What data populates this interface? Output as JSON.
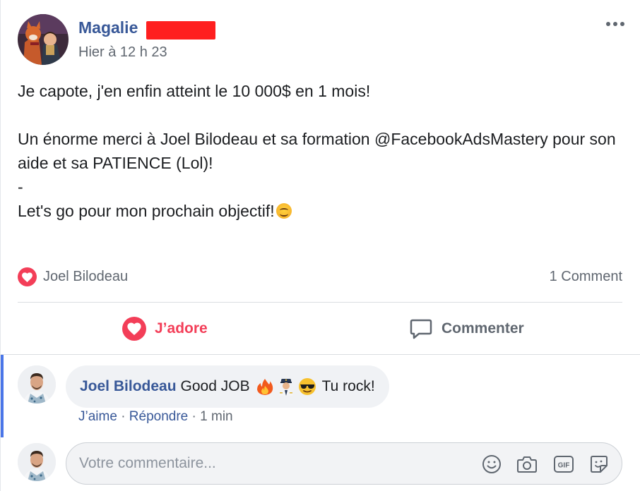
{
  "post": {
    "author": "Magalie",
    "timestamp": "Hier à 12 h 23",
    "text_line1": "Je capote, j'en enfin atteint le 10 000$ en 1 mois!",
    "text_line2": "Un énorme merci à Joel Bilodeau et sa formation @FacebookAdsMastery pour son aide et sa PATIENCE (Lol)!",
    "text_line3": "-",
    "text_line4": "Let's go pour mon prochain objectif!",
    "more_icon": "more-options-icon"
  },
  "reactions": {
    "reacted_by": "Joel Bilodeau",
    "comment_count": "1 Comment",
    "reaction_icon": "heart-icon"
  },
  "actions": {
    "love_label": "J’adore",
    "comment_label": "Commenter"
  },
  "comment": {
    "author": "Joel Bilodeau",
    "text_start": "Good JOB",
    "text_end": "Tu rock!",
    "like_label": "J’aime",
    "separator": "·",
    "reply_label": "Répondre",
    "time": "1 min"
  },
  "composer": {
    "placeholder": "Votre commentaire...",
    "icons": [
      "emoji-icon",
      "camera-icon",
      "gif-icon",
      "sticker-icon"
    ]
  },
  "colors": {
    "brand_blue": "#385898",
    "love_red": "#f33e58",
    "muted_text": "#606770",
    "accent_bar": "#4a76e8"
  }
}
